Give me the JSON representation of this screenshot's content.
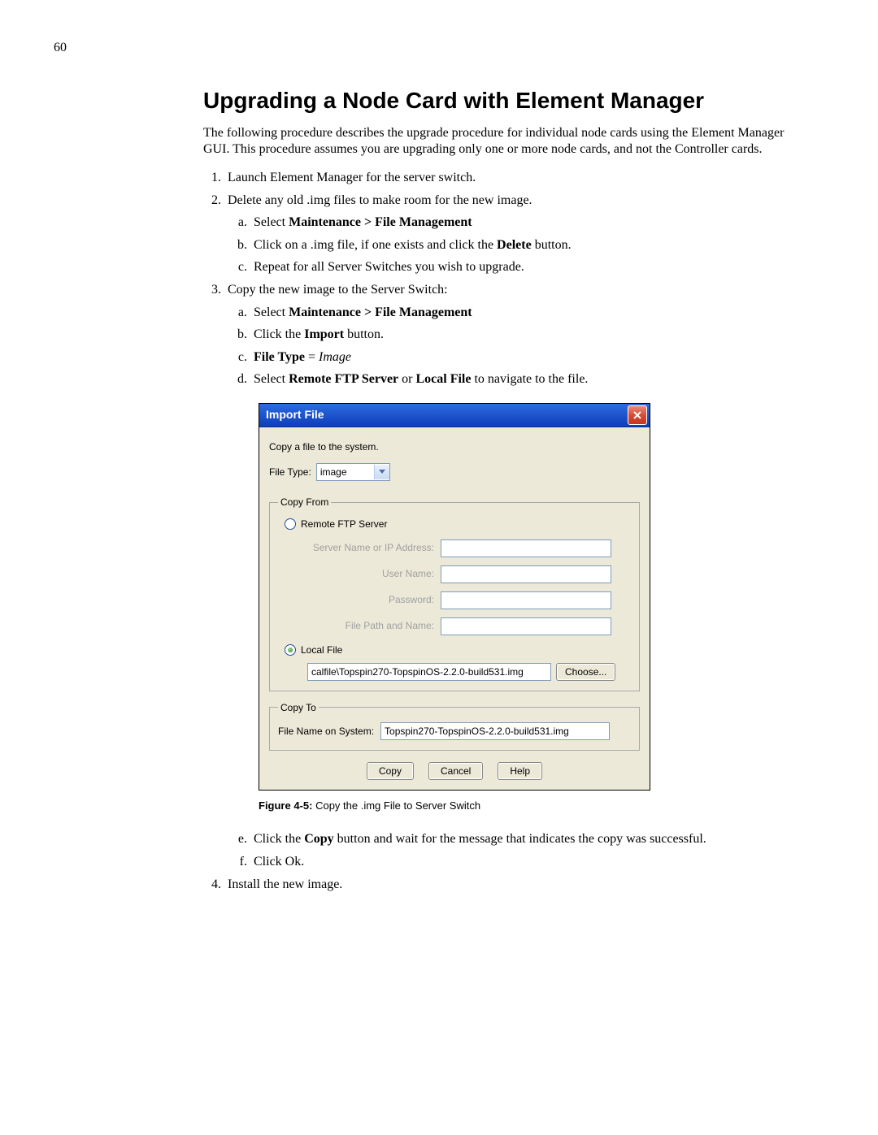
{
  "page_number": "60",
  "title": "Upgrading a Node Card with Element Manager",
  "intro": "The following procedure describes the upgrade procedure for individual node cards using the Element Manager GUI. This procedure assumes you are upgrading only one or more node cards, and not the Controller cards.",
  "steps": {
    "s1": "Launch Element Manager for the server switch.",
    "s2": "Delete any old .img files to make room for the new image.",
    "s2a_pre": "Select ",
    "s2a_bold": "Maintenance > File Management",
    "s2b_pre": "Click on a .img file, if one exists and click the ",
    "s2b_bold": "Delete",
    "s2b_post": " button.",
    "s2c": "Repeat for all Server Switches you wish to upgrade.",
    "s3": "Copy the new image to the Server Switch:",
    "s3a_pre": "Select ",
    "s3a_bold": "Maintenance > File Management",
    "s3b_pre": "Click the ",
    "s3b_bold": "Import",
    "s3b_post": " button.",
    "s3c_bold1": "File Type",
    "s3c_mid": " = ",
    "s3c_ital": "Image",
    "s3d_pre": "Select ",
    "s3d_bold1": "Remote FTP Server",
    "s3d_mid": " or ",
    "s3d_bold2": "Local File",
    "s3d_post": " to navigate to the file.",
    "s3e_pre": "Click the ",
    "s3e_bold": "Copy",
    "s3e_post": " button and wait for the message that indicates the copy was successful.",
    "s3f": "Click Ok.",
    "s4": "Install the new image."
  },
  "dialog": {
    "title": "Import File",
    "subtitle": "Copy a file to the system.",
    "filetype_label": "File Type:",
    "filetype_value": "image",
    "copyfrom_legend": "Copy From",
    "remote_label": "Remote FTP Server",
    "server_label": "Server Name or IP Address:",
    "user_label": "User Name:",
    "password_label": "Password:",
    "filepath_label": "File Path and Name:",
    "local_label": "Local File",
    "local_value": "calfile\\Topspin270-TopspinOS-2.2.0-build531.img",
    "choose_btn": "Choose...",
    "copyto_legend": "Copy To",
    "filename_label": "File Name on System:",
    "filename_value": "Topspin270-TopspinOS-2.2.0-build531.img",
    "copy_btn": "Copy",
    "cancel_btn": "Cancel",
    "help_btn": "Help"
  },
  "figure": {
    "num": "Figure 4-5:",
    "text": " Copy the .img File to Server Switch"
  }
}
